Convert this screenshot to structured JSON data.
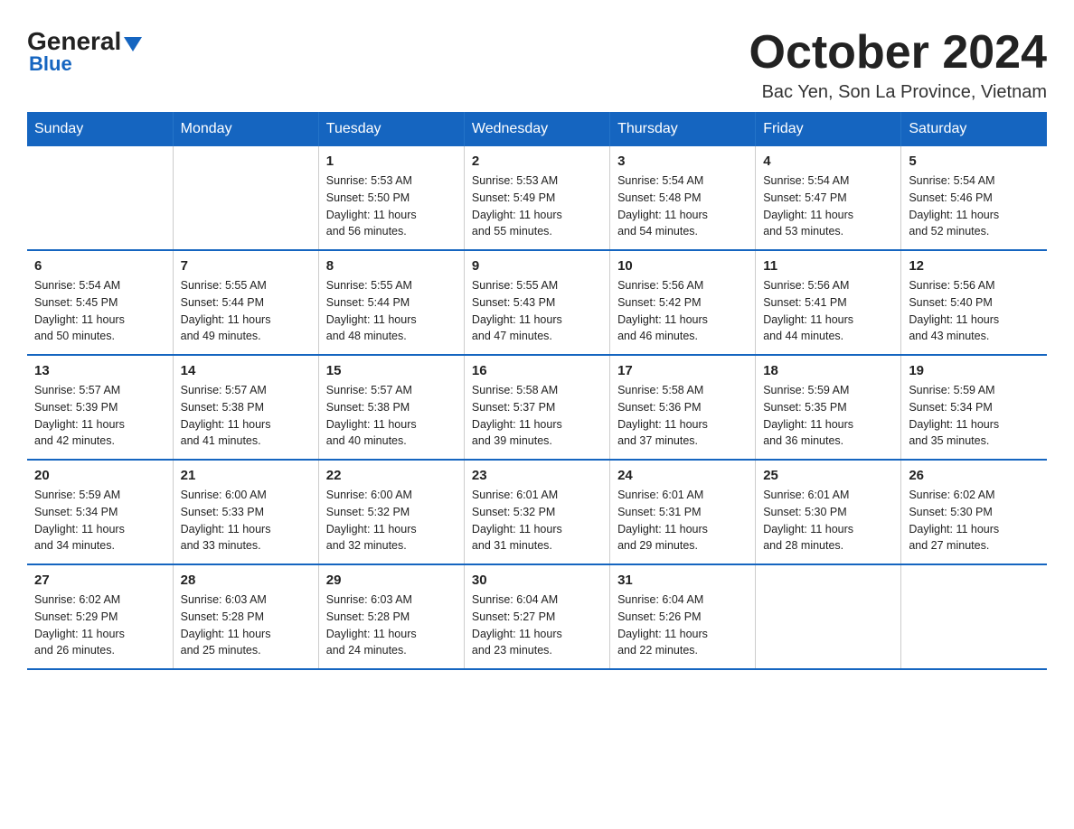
{
  "logo": {
    "general": "General",
    "triangle": "▲",
    "blue": "Blue"
  },
  "header": {
    "title": "October 2024",
    "location": "Bac Yen, Son La Province, Vietnam"
  },
  "weekdays": [
    "Sunday",
    "Monday",
    "Tuesday",
    "Wednesday",
    "Thursday",
    "Friday",
    "Saturday"
  ],
  "weeks": [
    [
      {
        "day": "",
        "info": ""
      },
      {
        "day": "",
        "info": ""
      },
      {
        "day": "1",
        "info": "Sunrise: 5:53 AM\nSunset: 5:50 PM\nDaylight: 11 hours\nand 56 minutes."
      },
      {
        "day": "2",
        "info": "Sunrise: 5:53 AM\nSunset: 5:49 PM\nDaylight: 11 hours\nand 55 minutes."
      },
      {
        "day": "3",
        "info": "Sunrise: 5:54 AM\nSunset: 5:48 PM\nDaylight: 11 hours\nand 54 minutes."
      },
      {
        "day": "4",
        "info": "Sunrise: 5:54 AM\nSunset: 5:47 PM\nDaylight: 11 hours\nand 53 minutes."
      },
      {
        "day": "5",
        "info": "Sunrise: 5:54 AM\nSunset: 5:46 PM\nDaylight: 11 hours\nand 52 minutes."
      }
    ],
    [
      {
        "day": "6",
        "info": "Sunrise: 5:54 AM\nSunset: 5:45 PM\nDaylight: 11 hours\nand 50 minutes."
      },
      {
        "day": "7",
        "info": "Sunrise: 5:55 AM\nSunset: 5:44 PM\nDaylight: 11 hours\nand 49 minutes."
      },
      {
        "day": "8",
        "info": "Sunrise: 5:55 AM\nSunset: 5:44 PM\nDaylight: 11 hours\nand 48 minutes."
      },
      {
        "day": "9",
        "info": "Sunrise: 5:55 AM\nSunset: 5:43 PM\nDaylight: 11 hours\nand 47 minutes."
      },
      {
        "day": "10",
        "info": "Sunrise: 5:56 AM\nSunset: 5:42 PM\nDaylight: 11 hours\nand 46 minutes."
      },
      {
        "day": "11",
        "info": "Sunrise: 5:56 AM\nSunset: 5:41 PM\nDaylight: 11 hours\nand 44 minutes."
      },
      {
        "day": "12",
        "info": "Sunrise: 5:56 AM\nSunset: 5:40 PM\nDaylight: 11 hours\nand 43 minutes."
      }
    ],
    [
      {
        "day": "13",
        "info": "Sunrise: 5:57 AM\nSunset: 5:39 PM\nDaylight: 11 hours\nand 42 minutes."
      },
      {
        "day": "14",
        "info": "Sunrise: 5:57 AM\nSunset: 5:38 PM\nDaylight: 11 hours\nand 41 minutes."
      },
      {
        "day": "15",
        "info": "Sunrise: 5:57 AM\nSunset: 5:38 PM\nDaylight: 11 hours\nand 40 minutes."
      },
      {
        "day": "16",
        "info": "Sunrise: 5:58 AM\nSunset: 5:37 PM\nDaylight: 11 hours\nand 39 minutes."
      },
      {
        "day": "17",
        "info": "Sunrise: 5:58 AM\nSunset: 5:36 PM\nDaylight: 11 hours\nand 37 minutes."
      },
      {
        "day": "18",
        "info": "Sunrise: 5:59 AM\nSunset: 5:35 PM\nDaylight: 11 hours\nand 36 minutes."
      },
      {
        "day": "19",
        "info": "Sunrise: 5:59 AM\nSunset: 5:34 PM\nDaylight: 11 hours\nand 35 minutes."
      }
    ],
    [
      {
        "day": "20",
        "info": "Sunrise: 5:59 AM\nSunset: 5:34 PM\nDaylight: 11 hours\nand 34 minutes."
      },
      {
        "day": "21",
        "info": "Sunrise: 6:00 AM\nSunset: 5:33 PM\nDaylight: 11 hours\nand 33 minutes."
      },
      {
        "day": "22",
        "info": "Sunrise: 6:00 AM\nSunset: 5:32 PM\nDaylight: 11 hours\nand 32 minutes."
      },
      {
        "day": "23",
        "info": "Sunrise: 6:01 AM\nSunset: 5:32 PM\nDaylight: 11 hours\nand 31 minutes."
      },
      {
        "day": "24",
        "info": "Sunrise: 6:01 AM\nSunset: 5:31 PM\nDaylight: 11 hours\nand 29 minutes."
      },
      {
        "day": "25",
        "info": "Sunrise: 6:01 AM\nSunset: 5:30 PM\nDaylight: 11 hours\nand 28 minutes."
      },
      {
        "day": "26",
        "info": "Sunrise: 6:02 AM\nSunset: 5:30 PM\nDaylight: 11 hours\nand 27 minutes."
      }
    ],
    [
      {
        "day": "27",
        "info": "Sunrise: 6:02 AM\nSunset: 5:29 PM\nDaylight: 11 hours\nand 26 minutes."
      },
      {
        "day": "28",
        "info": "Sunrise: 6:03 AM\nSunset: 5:28 PM\nDaylight: 11 hours\nand 25 minutes."
      },
      {
        "day": "29",
        "info": "Sunrise: 6:03 AM\nSunset: 5:28 PM\nDaylight: 11 hours\nand 24 minutes."
      },
      {
        "day": "30",
        "info": "Sunrise: 6:04 AM\nSunset: 5:27 PM\nDaylight: 11 hours\nand 23 minutes."
      },
      {
        "day": "31",
        "info": "Sunrise: 6:04 AM\nSunset: 5:26 PM\nDaylight: 11 hours\nand 22 minutes."
      },
      {
        "day": "",
        "info": ""
      },
      {
        "day": "",
        "info": ""
      }
    ]
  ]
}
